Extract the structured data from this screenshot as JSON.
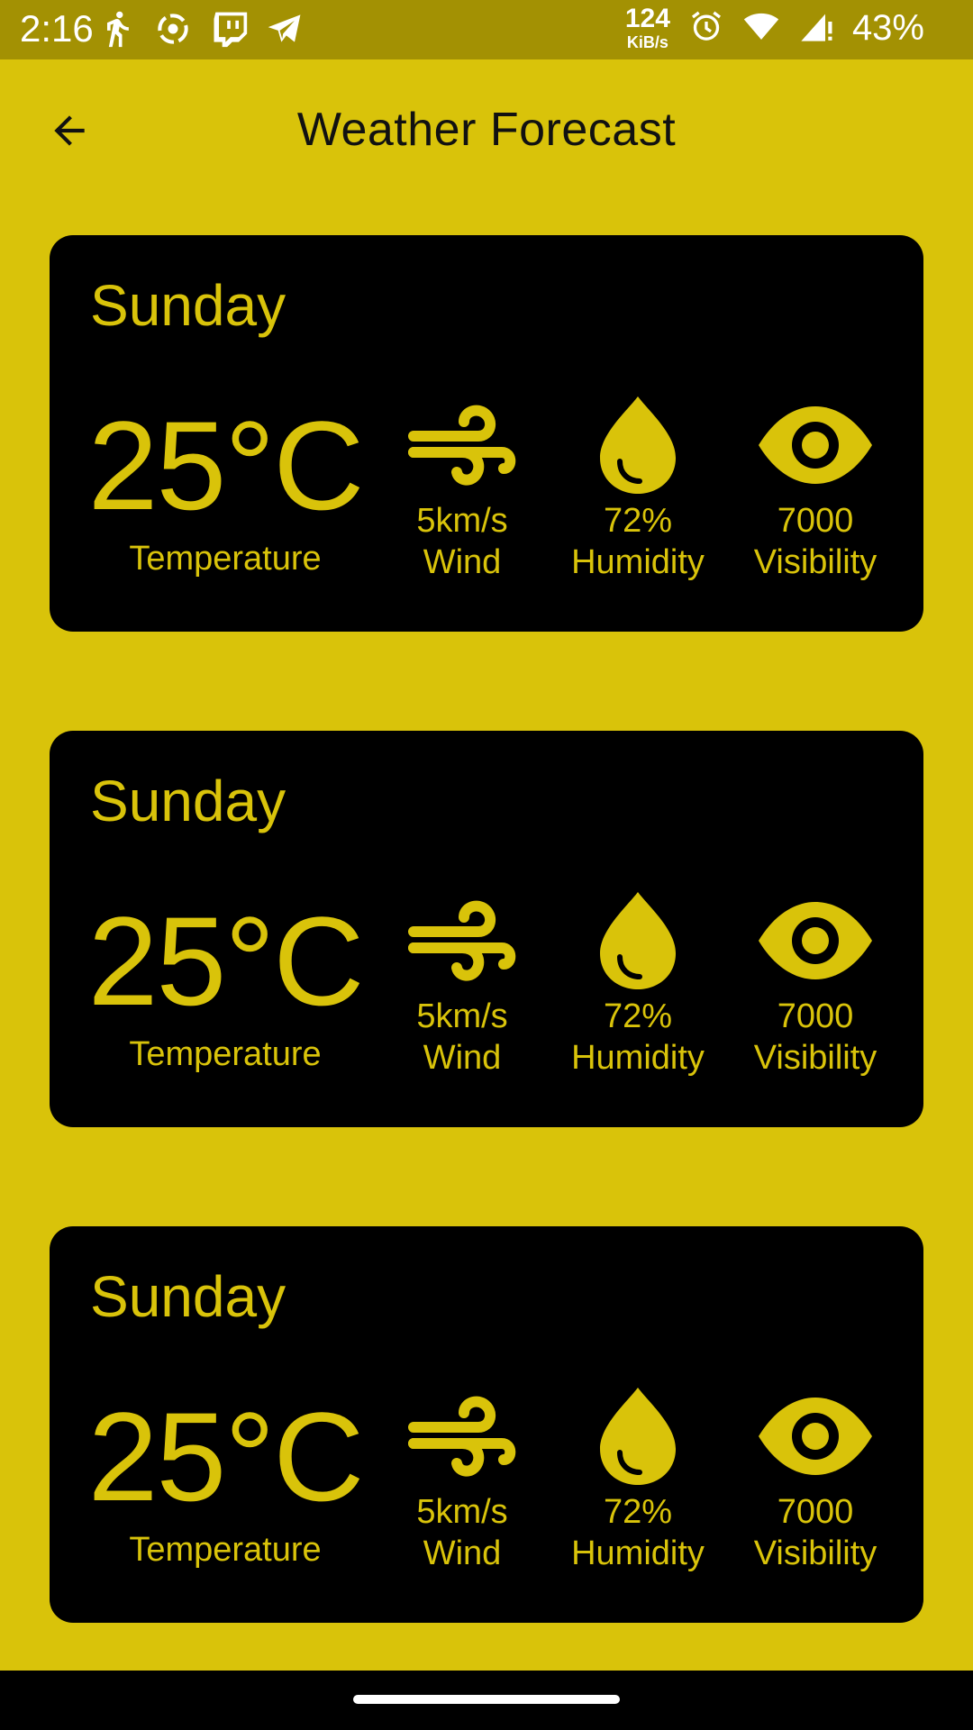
{
  "status_bar": {
    "time": "2:16",
    "net_speed_value": "124",
    "net_speed_unit": "KiB/s",
    "battery": "43%",
    "left_icons": [
      "running-icon",
      "cast-icon",
      "twitch-icon",
      "telegram-icon"
    ],
    "right_icons": [
      "alarm-icon",
      "wifi-icon",
      "signal-icon"
    ]
  },
  "app_bar": {
    "title": "Weather Forecast",
    "back_icon": "arrow-left-icon"
  },
  "colors": {
    "accent": "#d9c30a",
    "status_bar": "#a39103",
    "card_bg": "#000000",
    "title_text": "#111111"
  },
  "forecasts": [
    {
      "day": "Sunday",
      "temperature": "25°C",
      "temperature_label": "Temperature",
      "wind_value": "5km/s",
      "wind_label": "Wind",
      "humidity_value": "72%",
      "humidity_label": "Humidity",
      "visibility_value": "7000",
      "visibility_label": "Visibility"
    },
    {
      "day": "Sunday",
      "temperature": "25°C",
      "temperature_label": "Temperature",
      "wind_value": "5km/s",
      "wind_label": "Wind",
      "humidity_value": "72%",
      "humidity_label": "Humidity",
      "visibility_value": "7000",
      "visibility_label": "Visibility"
    },
    {
      "day": "Sunday",
      "temperature": "25°C",
      "temperature_label": "Temperature",
      "wind_value": "5km/s",
      "wind_label": "Wind",
      "humidity_value": "72%",
      "humidity_label": "Humidity",
      "visibility_value": "7000",
      "visibility_label": "Visibility"
    }
  ]
}
